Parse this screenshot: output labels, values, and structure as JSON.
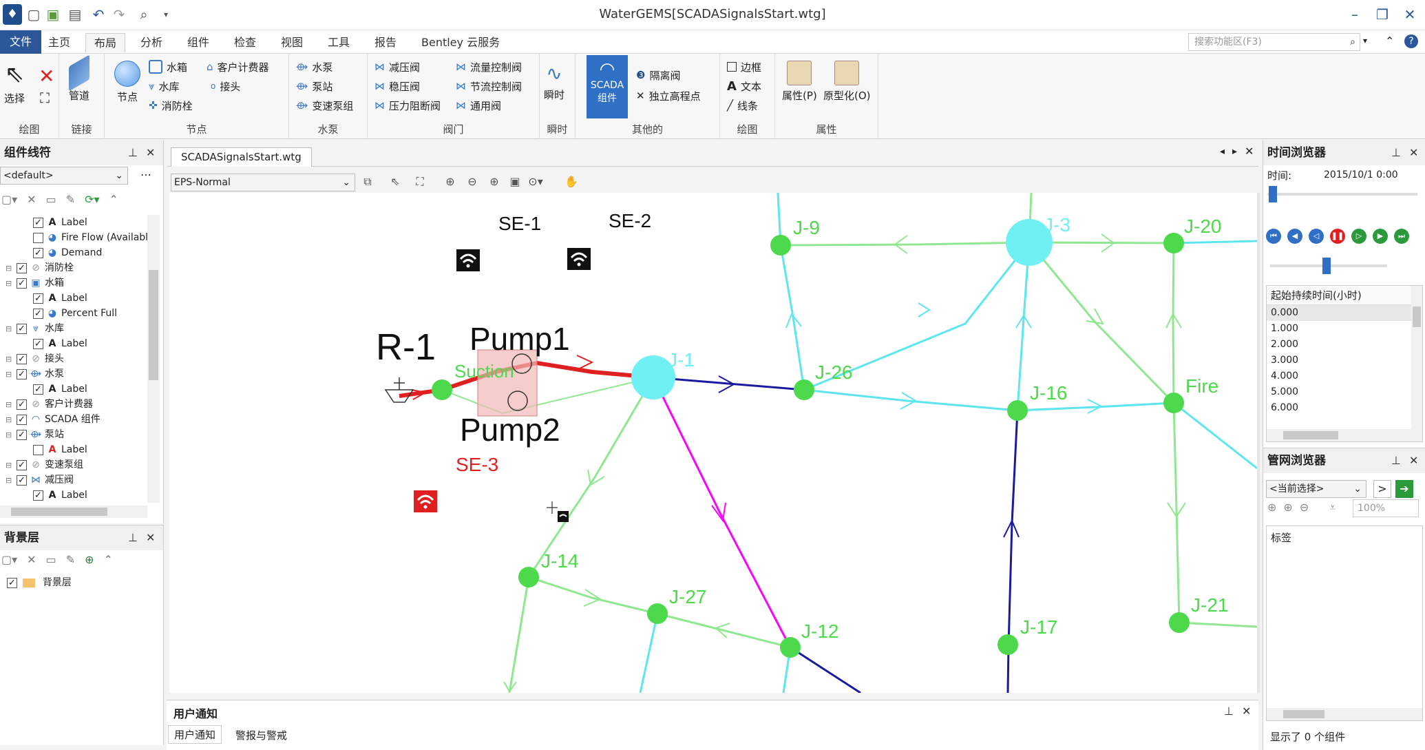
{
  "app": {
    "title": "WaterGEMS[SCADASignalsStart.wtg]"
  },
  "menu": {
    "items": [
      "文件",
      "主页",
      "布局",
      "分析",
      "组件",
      "检查",
      "视图",
      "工具",
      "报告",
      "Bentley 云服务"
    ],
    "search_placeholder": "搜索功能区(F3)"
  },
  "ribbon": {
    "draw": {
      "label": "绘图",
      "select": "选择"
    },
    "link": {
      "label": "链接",
      "pipe": "管道"
    },
    "node": {
      "label": "节点",
      "node": "节点",
      "tank": "水箱",
      "reservoir": "水库",
      "hydrant": "消防栓",
      "meter": "客户计费器",
      "junction": "接头"
    },
    "pump": {
      "label": "水泵",
      "pump": "水泵",
      "station": "泵站",
      "vsp": "变速泵组"
    },
    "valve": {
      "label": "阀门",
      "prv": "减压阀",
      "psv": "稳压阀",
      "pbv": "压力阻断阀",
      "fcv": "流量控制阀",
      "tcv": "节流控制阀",
      "gpv": "通用阀"
    },
    "transient": {
      "label": "瞬时",
      "btn": "瞬时"
    },
    "other": {
      "label": "其他的",
      "scada": "SCADA 组件",
      "isolation": "隔离阀",
      "spot": "独立高程点"
    },
    "drawing": {
      "label": "绘图",
      "border": "边框",
      "text": "文本",
      "line": "线条"
    },
    "props": {
      "label": "属性",
      "props": "属性(P)",
      "proto": "原型化(O)"
    }
  },
  "left_panel": {
    "title": "组件线符",
    "dropdown": "<default>",
    "tree": [
      {
        "indent": 2,
        "checked": true,
        "icon": "A",
        "label": "Label"
      },
      {
        "indent": 2,
        "checked": false,
        "icon": "pie",
        "label": "Fire Flow (Availabl"
      },
      {
        "indent": 2,
        "checked": true,
        "icon": "pie",
        "label": "Demand"
      },
      {
        "indent": 1,
        "checked": true,
        "icon": "hydrant",
        "label": "消防栓"
      },
      {
        "indent": 1,
        "checked": true,
        "icon": "tank",
        "label": "水箱"
      },
      {
        "indent": 2,
        "checked": true,
        "icon": "A",
        "label": "Label"
      },
      {
        "indent": 2,
        "checked": true,
        "icon": "pie",
        "label": "Percent Full"
      },
      {
        "indent": 1,
        "checked": true,
        "icon": "reservoir",
        "label": "水库"
      },
      {
        "indent": 2,
        "checked": true,
        "icon": "A",
        "label": "Label"
      },
      {
        "indent": 1,
        "checked": true,
        "icon": "junction",
        "label": "接头"
      },
      {
        "indent": 1,
        "checked": true,
        "icon": "pump",
        "label": "水泵"
      },
      {
        "indent": 2,
        "checked": true,
        "icon": "A",
        "label": "Label"
      },
      {
        "indent": 1,
        "checked": true,
        "icon": "meter",
        "label": "客户计费器"
      },
      {
        "indent": 1,
        "checked": true,
        "icon": "scada",
        "label": "SCADA 组件"
      },
      {
        "indent": 1,
        "checked": true,
        "icon": "station",
        "label": "泵站"
      },
      {
        "indent": 2,
        "checked": false,
        "icon": "Ax",
        "label": "Label"
      },
      {
        "indent": 1,
        "checked": true,
        "icon": "vsp",
        "label": "变速泵组"
      },
      {
        "indent": 1,
        "checked": true,
        "icon": "prv",
        "label": "减压阀"
      },
      {
        "indent": 2,
        "checked": true,
        "icon": "A",
        "label": "Label"
      }
    ]
  },
  "bg_panel": {
    "title": "背景层",
    "item": "背景层"
  },
  "doc": {
    "tab": "SCADASignalsStart.wtg",
    "view_dropdown": "EPS-Normal"
  },
  "map": {
    "labels": {
      "se1": "SE-1",
      "se2": "SE-2",
      "se3": "SE-3",
      "r1": "R-1",
      "pump1": "Pump1",
      "pump2": "Pump2",
      "suction": "Suction",
      "j1": "J-1",
      "j3": "J-3",
      "j9": "J-9",
      "j20": "J-20",
      "j26": "J-26",
      "j16": "J-16",
      "fire": "Fire",
      "j14": "J-14",
      "j27": "J-27",
      "j12": "J-12",
      "j17": "J-17",
      "j21": "J-21"
    }
  },
  "time_browser": {
    "title": "时间浏览器",
    "time_label": "时间:",
    "time_value": "2015/10/1 0:00",
    "list_header": "起始持续时间(小时)",
    "times": [
      "0.000",
      "1.000",
      "2.000",
      "3.000",
      "4.000",
      "5.000",
      "6.000"
    ]
  },
  "net_browser": {
    "title": "管网浏览器",
    "dropdown": "<当前选择>",
    "zoom": "100%",
    "tag_label": "标签",
    "status": "显示了 0 个组件"
  },
  "notify": {
    "title": "用户通知",
    "tabs": [
      "用户通知",
      "警报与警戒"
    ]
  },
  "colors": {
    "accent": "#2b579a",
    "junction": "#4cd94c",
    "large_node": "#6ff0f5",
    "red_pipe": "#e02020",
    "magenta_pipe": "#ff00ff",
    "blue_pipe": "#1a1aa0",
    "green_pipe": "#8fe88f",
    "cyan_pipe": "#5ee6ee",
    "scada_red": "#e02020"
  }
}
